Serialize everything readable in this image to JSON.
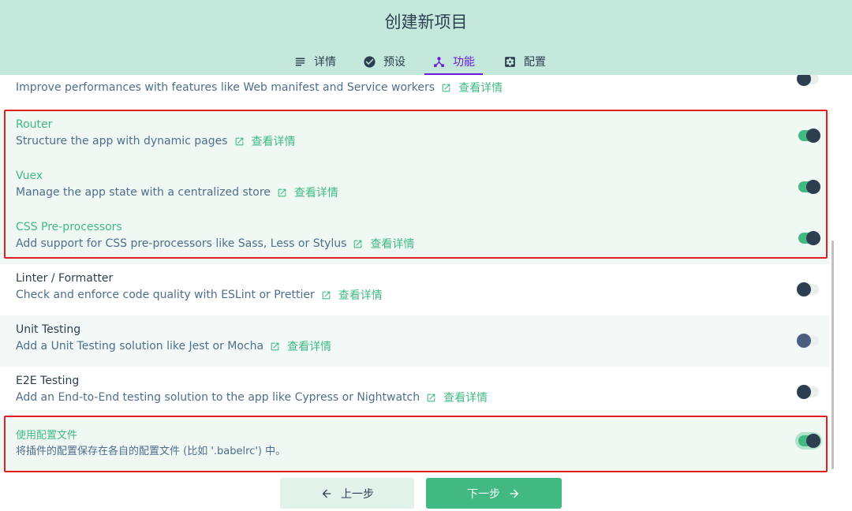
{
  "header": {
    "title": "创建新项目",
    "tabs": [
      {
        "label": "详情",
        "icon": "subject-icon"
      },
      {
        "label": "预设",
        "icon": "check-circle-icon"
      },
      {
        "label": "功能",
        "icon": "device-hub-icon",
        "active": true
      },
      {
        "label": "配置",
        "icon": "settings-applications-icon"
      }
    ]
  },
  "features": {
    "more_label": "查看详情",
    "pwa": {
      "desc": "Improve performances with features like Web manifest and Service workers",
      "enabled": false
    },
    "router": {
      "name": "Router",
      "desc": "Structure the app with dynamic pages",
      "enabled": true
    },
    "vuex": {
      "name": "Vuex",
      "desc": "Manage the app state with a centralized store",
      "enabled": true
    },
    "css": {
      "name": "CSS Pre-processors",
      "desc": "Add support for CSS pre-processors like Sass, Less or Stylus",
      "enabled": true
    },
    "linter": {
      "name": "Linter / Formatter",
      "desc": "Check and enforce code quality with ESLint or Prettier",
      "enabled": false
    },
    "unit": {
      "name": "Unit Testing",
      "desc": "Add a Unit Testing solution like Jest or Mocha",
      "enabled": false
    },
    "e2e": {
      "name": "E2E Testing",
      "desc": "Add an End-to-End testing solution to the app like Cypress or Nightwatch",
      "enabled": false
    },
    "config": {
      "name": "使用配置文件",
      "desc": "将插件的配置保存在各自的配置文件 (比如 '.babelrc') 中。",
      "enabled": true
    }
  },
  "footer": {
    "prev_label": "上一步",
    "next_label": "下一步"
  },
  "colors": {
    "accent": "#42b983",
    "header_bg": "#c4e9dc",
    "active_tab": "#6a1bd8",
    "annotation": "#e02020"
  }
}
